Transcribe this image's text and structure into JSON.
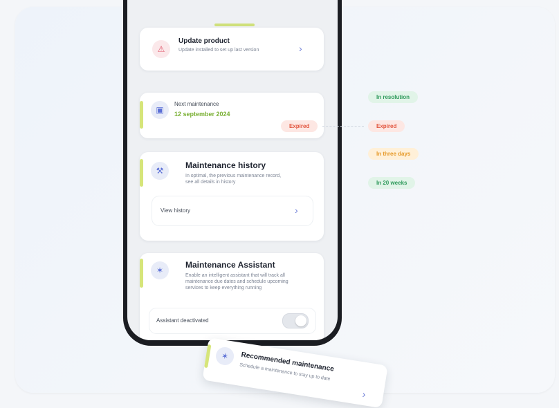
{
  "update_card": {
    "title": "Update product",
    "subtitle": "Update installed to set up last version"
  },
  "next_maintenance": {
    "label": "Next maintenance",
    "date": "12 september 2024",
    "status_badge": "Expired"
  },
  "status_options": [
    {
      "label": "In resolution",
      "color": "#2f9a5c"
    },
    {
      "label": "Expired",
      "color": "#e2553e"
    },
    {
      "label": "In three days",
      "color": "#e69a2a"
    },
    {
      "label": "In 20 weeks",
      "color": "#2f9a5c"
    }
  ],
  "history_card": {
    "title": "Maintenance history",
    "subtitle": "In optimal, the previous maintenance record, see all details in history",
    "row_label": "View history"
  },
  "assistant_card": {
    "title": "Maintenance Assistant",
    "subtitle": "Enable an intelligent assistant that will track all maintenance due dates and schedule upcoming services to keep everything running",
    "toggle_label": "Assistant deactivated",
    "toggle_on": false
  },
  "floating_card": {
    "title": "Recommended maintenance",
    "subtitle": "Schedule a maintenance to stay up to date"
  },
  "icons": {
    "update": "alert-icon",
    "calendar": "calendar-icon",
    "wrench": "wrench-icon",
    "assistant": "sparkle-icon",
    "chevron": "chevron-right-icon"
  },
  "colors": {
    "accent": "#d6e57a",
    "link": "#6f7fd8",
    "date_green": "#7ab034"
  }
}
